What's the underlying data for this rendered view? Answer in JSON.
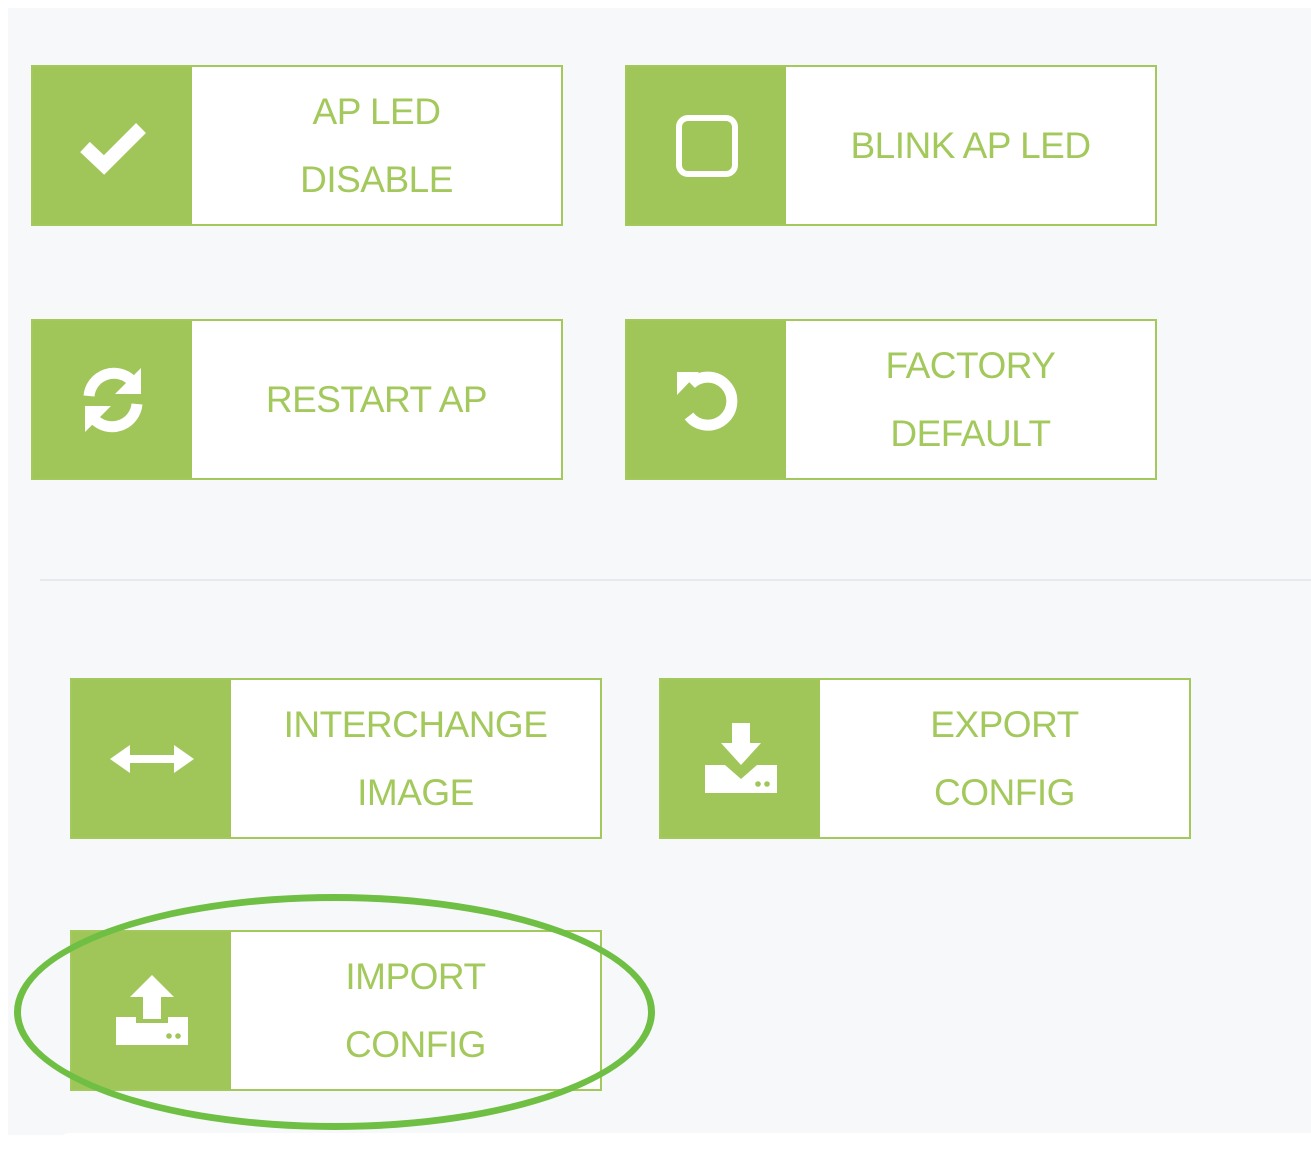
{
  "buttons": {
    "led_disable": {
      "label": "AP LED\nDISABLE",
      "icon": "check-icon"
    },
    "blink_led": {
      "label": "BLINK AP LED",
      "icon": "square-icon"
    },
    "restart": {
      "label": "RESTART AP",
      "icon": "refresh-icon"
    },
    "factory_default": {
      "label": "FACTORY\nDEFAULT",
      "icon": "undo-icon"
    },
    "interchange": {
      "label": "INTERCHANGE\nIMAGE",
      "icon": "swap-arrows-icon"
    },
    "export": {
      "label": "EXPORT\nCONFIG",
      "icon": "download-icon"
    },
    "import": {
      "label": "IMPORT\nCONFIG",
      "icon": "upload-icon"
    }
  },
  "colors": {
    "accent": "#a0c65a",
    "label": "#a3c95c",
    "highlight": "#6fbf44",
    "panel_bg": "#f7f8fa"
  }
}
